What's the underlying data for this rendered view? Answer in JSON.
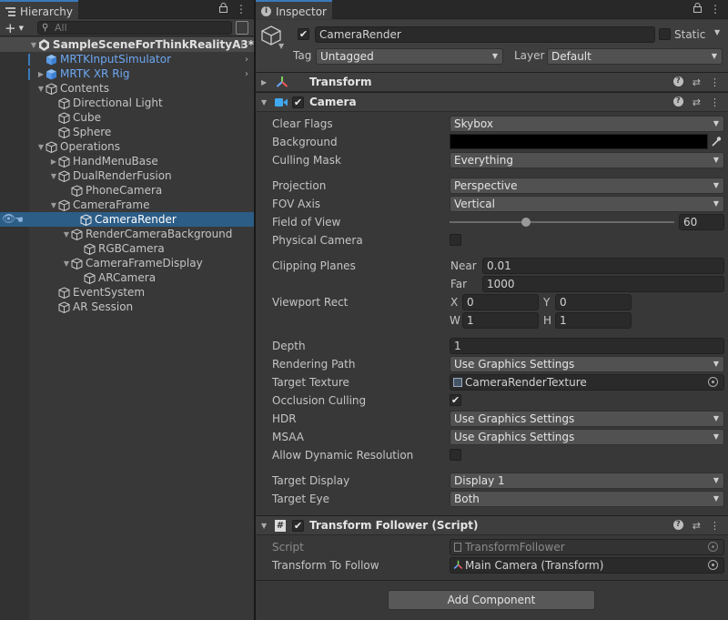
{
  "hierarchy": {
    "tab_title": "Hierarchy",
    "search_placeholder": "All",
    "scene_name": "SampleSceneForThinkRealityA3*",
    "items": [
      {
        "label": "MRTKInputSimulator",
        "blue": true
      },
      {
        "label": "MRTK XR Rig",
        "blue": true
      },
      {
        "label": "Contents"
      },
      {
        "label": "Directional Light"
      },
      {
        "label": "Cube"
      },
      {
        "label": "Sphere"
      },
      {
        "label": "Operations"
      },
      {
        "label": "HandMenuBase"
      },
      {
        "label": "DualRenderFusion"
      },
      {
        "label": "PhoneCamera"
      },
      {
        "label": "CameraFrame"
      },
      {
        "label": "CameraRender"
      },
      {
        "label": "RenderCameraBackground"
      },
      {
        "label": "RGBCamera"
      },
      {
        "label": "CameraFrameDisplay"
      },
      {
        "label": "ARCamera"
      },
      {
        "label": "EventSystem"
      },
      {
        "label": "AR Session"
      }
    ]
  },
  "inspector": {
    "tab_title": "Inspector",
    "object_name": "CameraRender",
    "static_label": "Static",
    "tag_label": "Tag",
    "tag_value": "Untagged",
    "layer_label": "Layer",
    "layer_value": "Default",
    "transform": {
      "title": "Transform"
    },
    "camera": {
      "title": "Camera",
      "clear_flags": {
        "label": "Clear Flags",
        "value": "Skybox"
      },
      "background": {
        "label": "Background",
        "color": "#000000"
      },
      "culling_mask": {
        "label": "Culling Mask",
        "value": "Everything"
      },
      "projection": {
        "label": "Projection",
        "value": "Perspective"
      },
      "fov_axis": {
        "label": "FOV Axis",
        "value": "Vertical"
      },
      "field_of_view": {
        "label": "Field of View",
        "value": "60",
        "slider_fraction": 0.34
      },
      "physical_camera": {
        "label": "Physical Camera",
        "checked": false
      },
      "clipping_planes": {
        "label": "Clipping Planes",
        "near_label": "Near",
        "near": "0.01",
        "far_label": "Far",
        "far": "1000"
      },
      "viewport_rect": {
        "label": "Viewport Rect",
        "x_label": "X",
        "x": "0",
        "y_label": "Y",
        "y": "0",
        "w_label": "W",
        "w": "1",
        "h_label": "H",
        "h": "1"
      },
      "depth": {
        "label": "Depth",
        "value": "1"
      },
      "rendering_path": {
        "label": "Rendering Path",
        "value": "Use Graphics Settings"
      },
      "target_texture": {
        "label": "Target Texture",
        "value": "CameraRenderTexture"
      },
      "occlusion_culling": {
        "label": "Occlusion Culling",
        "checked": true
      },
      "hdr": {
        "label": "HDR",
        "value": "Use Graphics Settings"
      },
      "msaa": {
        "label": "MSAA",
        "value": "Use Graphics Settings"
      },
      "allow_dynamic_resolution": {
        "label": "Allow Dynamic Resolution",
        "checked": false
      },
      "target_display": {
        "label": "Target Display",
        "value": "Display 1"
      },
      "target_eye": {
        "label": "Target Eye",
        "value": "Both"
      }
    },
    "transform_follower": {
      "title": "Transform Follower (Script)",
      "script_label": "Script",
      "script_value": "TransformFollower",
      "follow_label": "Transform To Follow",
      "follow_value": "Main Camera (Transform)"
    },
    "add_component": "Add Component"
  },
  "colors": {
    "accent": "#3a79bb",
    "selection": "#2c5d87",
    "prefab_blue": "#6ca7f2"
  },
  "glyphs": {
    "check": "✔",
    "caret_down": "▼",
    "caret_right": "▶",
    "chevron_right": "›",
    "lock": "🔒",
    "kebab": "⋮"
  }
}
